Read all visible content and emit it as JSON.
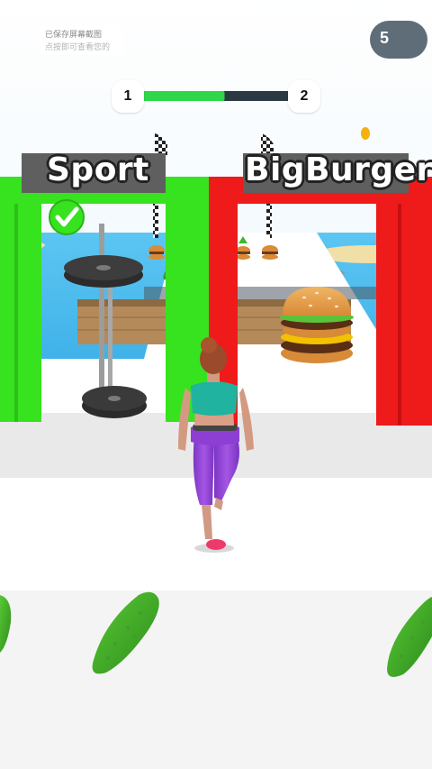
{
  "system": {
    "screenshot_toast": {
      "line1": "已保存屏幕截图",
      "line2": "点按即可查看您的"
    }
  },
  "hud": {
    "coins": "5",
    "level_progress": {
      "current_level": "1",
      "next_level": "2",
      "progress_fraction": 0.55
    }
  },
  "gates": {
    "left": {
      "label": "Sport",
      "color": "#37e21f",
      "state": "selected"
    },
    "right": {
      "label": "BigBurger",
      "color": "#ef1a1a"
    }
  },
  "colors": {
    "sky": "#c9e6f6",
    "sea": "#3fb2ea",
    "track": "#ffffff",
    "coin": "#f5b20d",
    "player_top": "#1fb3a0",
    "player_leggings": "#8d3fd3"
  },
  "icons": [
    "check-icon",
    "coin-icon",
    "barbell-icon",
    "burger-icon",
    "cucumber-icon",
    "finish-flag-icon"
  ]
}
